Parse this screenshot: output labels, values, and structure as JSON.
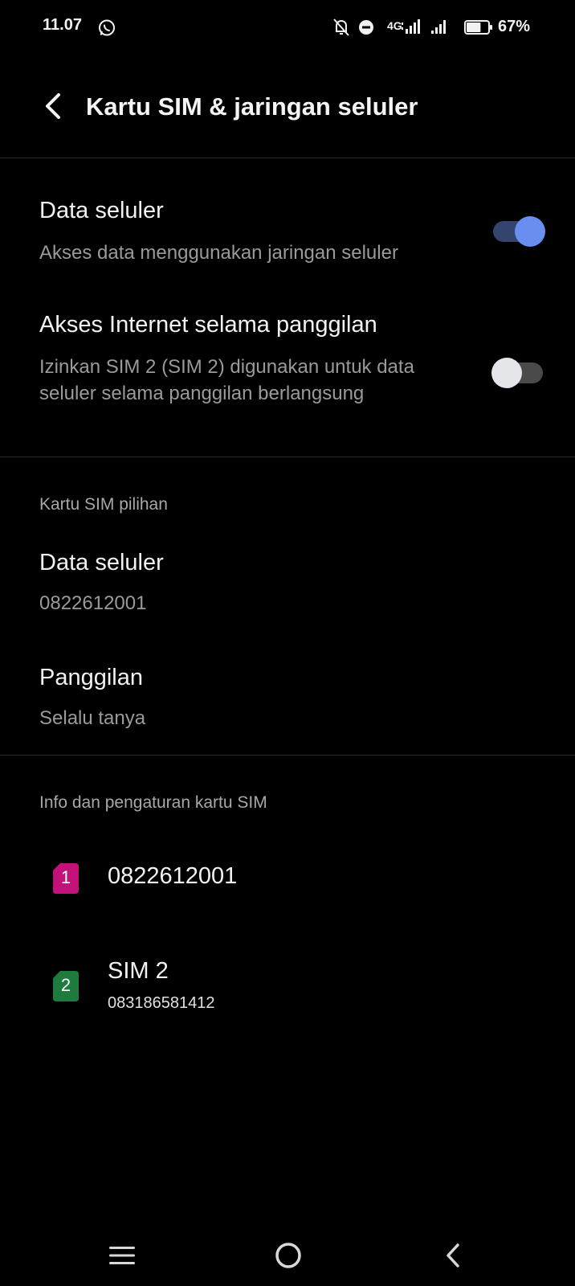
{
  "status_bar": {
    "time": "11.07",
    "network_type": "4G",
    "battery_percent": "67%",
    "battery_level": 0.67,
    "icons": [
      "whatsapp-icon",
      "mute-notifications-icon",
      "do-not-disturb-icon",
      "signal-sim1-icon",
      "signal-sim2-icon",
      "battery-icon"
    ]
  },
  "header": {
    "title": "Kartu SIM & jaringan seluler",
    "back_icon": "back-arrow-icon"
  },
  "settings": {
    "mobile_data": {
      "title": "Data seluler",
      "subtitle": "Akses data menggunakan jaringan seluler",
      "enabled": true
    },
    "internet_during_call": {
      "title": "Akses Internet selama panggilan",
      "subtitle": "Izinkan SIM 2 (SIM 2) digunakan untuk data seluler selama panggilan berlangsung",
      "enabled": false
    }
  },
  "preferred_sim": {
    "section_title": "Kartu SIM pilihan",
    "data": {
      "title": "Data seluler",
      "value": "0822612001"
    },
    "calls": {
      "title": "Panggilan",
      "value": "Selalu tanya"
    }
  },
  "sim_info": {
    "section_title": "Info dan pengaturan kartu SIM",
    "sims": [
      {
        "slot": "1",
        "name": "0822612001",
        "number": "",
        "color": "#c2127a"
      },
      {
        "slot": "2",
        "name": "SIM 2",
        "number": "083186581412",
        "color": "#1f7a3d"
      }
    ]
  },
  "toggle_colors": {
    "on_track": "#34446e",
    "on_thumb": "#6a8ef0",
    "off_track": "#4a4a4a",
    "off_thumb": "#e4e6ea"
  },
  "nav_bar": {
    "icons": [
      "menu-icon",
      "home-icon",
      "back-icon"
    ]
  }
}
